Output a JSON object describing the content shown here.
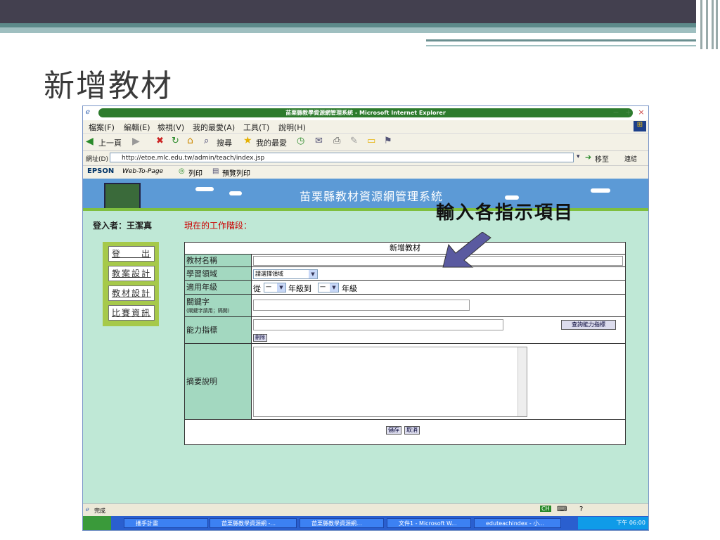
{
  "slide": {
    "title": "新增教材",
    "annotation": "輸入各指示項目"
  },
  "window": {
    "title": "苗栗縣教學資源網管理系統 - Microsoft Internet Explorer"
  },
  "menu": [
    "檔案(F)",
    "編輯(E)",
    "檢視(V)",
    "我的最愛(A)",
    "工具(T)",
    "說明(H)"
  ],
  "toolbar": {
    "back": "上一頁",
    "search": "搜尋",
    "favorites": "我的最愛"
  },
  "address": {
    "label": "網址(D)",
    "url": "http://etoe.mlc.edu.tw/admin/teach/index.jsp",
    "go": "移至",
    "links": "連結"
  },
  "epson": {
    "brand": "EPSON",
    "web_to_page": "Web-To-Page",
    "print": "列印",
    "preview": "預覽列印"
  },
  "site": {
    "banner_title": "苗栗縣教材資源網管理系統",
    "login_user": "登入者：王潔真",
    "stage": "現在的工作階段：",
    "side_menu": [
      "登　　出",
      "教案設計",
      "教材設計",
      "比賽資訊"
    ]
  },
  "form": {
    "header": "新增教材",
    "fields": {
      "name": "教材名稱",
      "domain": "學習領域",
      "domain_select": "請選擇領域",
      "grade": "適用年級",
      "grade_from": "從",
      "grade_start": "一",
      "grade_to_text": "年級到",
      "grade_end": "一",
      "grade_suffix": "年級",
      "keyword": "關鍵字",
      "keyword_hint": "(關鍵字請用；隔開)",
      "ability": "能力指標",
      "ability_query_btn": "查詢能力指標",
      "ability_delete_btn": "刪除",
      "summary": "摘要說明"
    },
    "save_btn": "儲存",
    "cancel_btn": "取消"
  },
  "status": {
    "text": "完成"
  },
  "taskbar": {
    "items": [
      "攜手計畫",
      "苗栗縣教學資源網 -...",
      "苗栗縣教學資源網...",
      "文件1 - Microsoft W...",
      "eduteachindex - 小..."
    ],
    "clock": "下午 06:00",
    "ime": "CH"
  }
}
